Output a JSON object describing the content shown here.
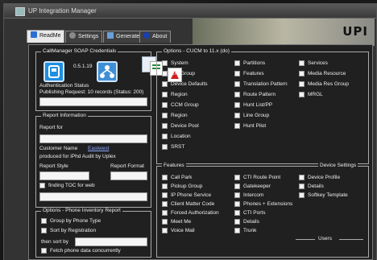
{
  "window": {
    "title": "UP Integration Manager"
  },
  "tabs": [
    {
      "label": "ReadMe",
      "icon": "readme-icon"
    },
    {
      "label": "Settings",
      "icon": "settings-icon"
    },
    {
      "label": "Generate",
      "icon": "generate-icon"
    },
    {
      "label": "About",
      "icon": "about-icon"
    }
  ],
  "banner": {
    "mark": "UPI"
  },
  "soap": {
    "legend": "CallManager SOAP Credentials",
    "version": "0.5.1.19",
    "auth_label": "Authentication Status",
    "status_label": "Publishing Request: 10 records (Status: 200)"
  },
  "report": {
    "legend": "Report Information",
    "report_for": "Report for",
    "customer_label": "Customer Name",
    "customer_value": "Eastwest",
    "produced": "produced for iPhd Audit by Uplex",
    "style_label": "Report Style",
    "format_label": "Report Format",
    "toc_label": "finding TOC for web"
  },
  "phone_inventory": {
    "legend": "Options - Phone Inventory Report",
    "group_by_phone_type": "Group by Phone Type",
    "sort_by_registration": "Sort by Registration",
    "then_sort_by": "then sort by",
    "fetch_phone_data": "Fetch phone data concurrently"
  },
  "options": {
    "legend": "Options - CUCM to 11.x (do)",
    "col1": [
      "System",
      "CM Group",
      "Device Defaults",
      "Region",
      "CCM Group",
      "Region",
      "Device Pool",
      "Location",
      "SRST"
    ],
    "col2": [
      "Partitions",
      "Features",
      "Translation Pattern",
      "Route Pattern",
      "Hunt List/PP",
      "Line Group",
      "Hunt Pilot"
    ],
    "col3": [
      "Services",
      "Media Resource",
      "Media Res Group",
      "MRGL"
    ]
  },
  "feature_opts": {
    "legend": "Features",
    "right_legend": "Device Settings",
    "col1": [
      "Call Park",
      "Pickup Group",
      "IP Phone Service",
      "Client Matter Code",
      "Forced Authorization",
      "Meet Me",
      "Voice Mail"
    ],
    "col2": [
      "CTI Route Point",
      "Gatekeeper",
      "Intercom",
      "Phones + Extensions",
      "CTI Ports",
      "Details",
      "Trunk"
    ],
    "col3": [
      "Device Profile",
      "Details",
      "Softkey Template"
    ],
    "users_label": "Users"
  }
}
